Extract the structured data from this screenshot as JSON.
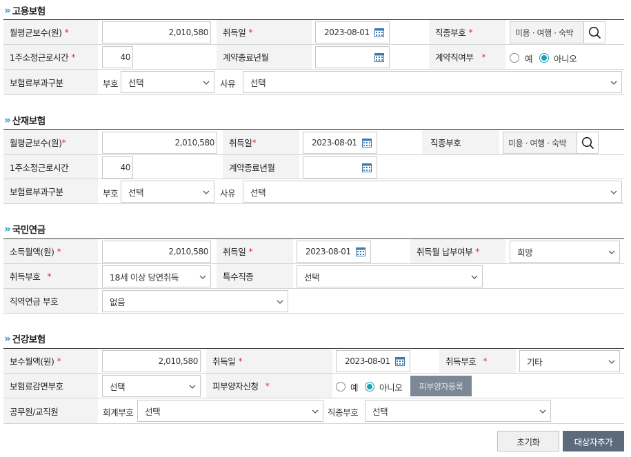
{
  "employment": {
    "title": "고용보험",
    "monthly_wage_label": "월평균보수(원)",
    "monthly_wage_value": "2,010,580",
    "acq_date_label": "취득일",
    "acq_date_value": "2023-08-01",
    "job_code_label": "직종부호",
    "job_code_value": "미용 · 여행 · 숙박",
    "hours_label": "1주소정근로시간",
    "hours_value": "40",
    "contract_end_label": "계약종료년월",
    "contract_end_value": "",
    "contract_job_label": "계약직여부",
    "radio_yes": "예",
    "radio_no": "아니오",
    "contract_selected": "아니오",
    "premium_label": "보험료부과구분",
    "code_label": "부호",
    "code_value": "선택",
    "reason_label": "사유",
    "reason_value": "선택"
  },
  "industrial": {
    "title": "산재보험",
    "monthly_wage_label": "월평균보수(원)",
    "monthly_wage_value": "2,010,580",
    "acq_date_label": "취득일",
    "acq_date_value": "2023-08-01",
    "job_code_label": "직종부호",
    "job_code_value": "미용 · 여행 · 숙박",
    "hours_label": "1주소정근로시간",
    "hours_value": "40",
    "contract_end_label": "계약종료년월",
    "contract_end_value": "",
    "premium_label": "보험료부과구분",
    "code_label": "부호",
    "code_value": "선택",
    "reason_label": "사유",
    "reason_value": "선택"
  },
  "pension": {
    "title": "국민연금",
    "income_label": "소득월액(원)",
    "income_value": "2,010,580",
    "acq_date_label": "취득일",
    "acq_date_value": "2023-08-01",
    "month_pay_label": "취득월 납부여부",
    "month_pay_value": "희망",
    "acq_code_label": "취득부호",
    "acq_code_value": "18세 이상 당연취득",
    "special_job_label": "특수직종",
    "special_job_value": "선택",
    "occ_pension_label": "직역연금 부호",
    "occ_pension_value": "없음"
  },
  "health": {
    "title": "건강보험",
    "wage_label": "보수월액(원)",
    "wage_value": "2,010,580",
    "acq_date_label": "취득일",
    "acq_date_value": "2023-08-01",
    "acq_code_label": "취득부호",
    "acq_code_value": "기타",
    "reduction_label": "보험료감면부호",
    "reduction_value": "선택",
    "dependent_label": "피부양자신청",
    "radio_yes": "예",
    "radio_no": "아니오",
    "dependent_selected": "아니오",
    "dependent_btn": "피부양자등록",
    "public_label": "공무원/교직원",
    "account_label": "회계부호",
    "account_value": "선택",
    "job_label": "직종부호",
    "job_value": "선택"
  },
  "buttons": {
    "reset": "초기화",
    "add": "대상자추가"
  },
  "colors": {
    "accent": "#1aa3b8",
    "required": "#e03030",
    "primary_button": "#5b6b7c"
  }
}
